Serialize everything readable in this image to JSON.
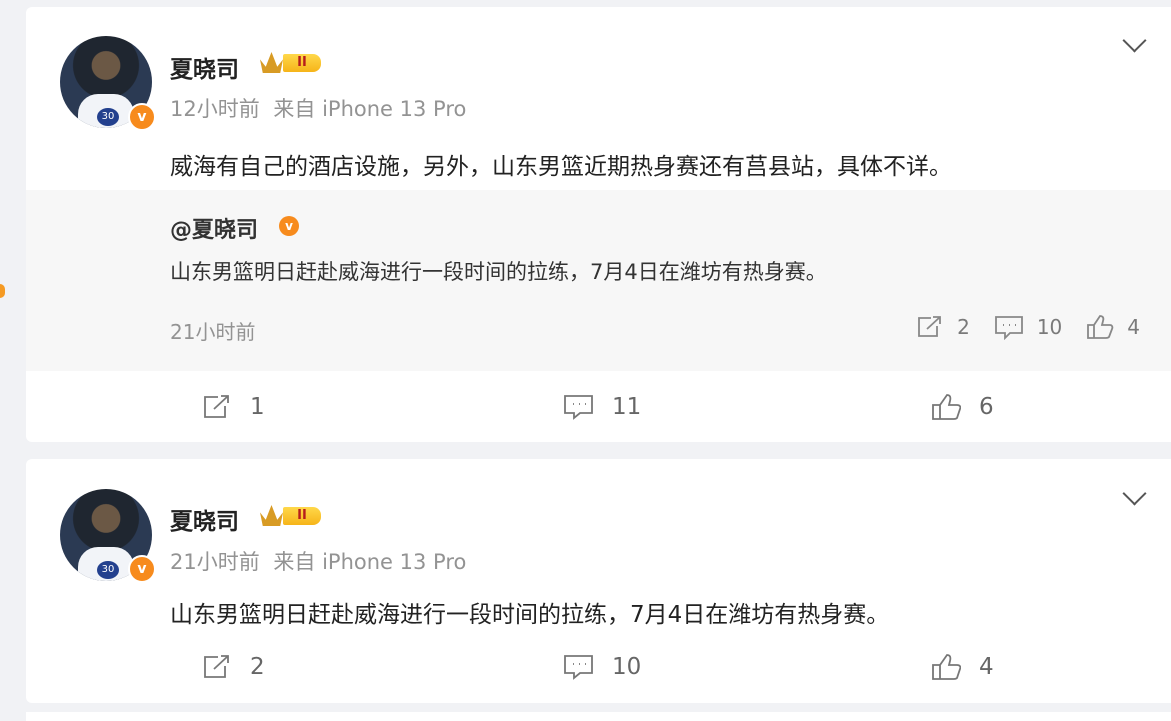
{
  "posts": [
    {
      "username": "夏晓司",
      "badge_level": "II",
      "time": "12小时前",
      "source": "来自 iPhone 13 Pro",
      "text": "威海有自己的酒店设施，另外，山东男篮近期热身赛还有莒县站，具体不详。",
      "retweet": {
        "author": "@夏晓司",
        "text": "山东男篮明日赶赴威海进行一段时间的拉练，7月4日在潍坊有热身赛。",
        "time": "21小时前",
        "actions": {
          "share_count": "2",
          "comment_count": "10",
          "like_count": "4"
        }
      },
      "actions": {
        "share_count": "1",
        "comment_count": "11",
        "like_count": "6"
      }
    },
    {
      "username": "夏晓司",
      "badge_level": "II",
      "time": "21小时前",
      "source": "来自 iPhone 13 Pro",
      "text": "山东男篮明日赶赴威海进行一段时间的拉练，7月4日在潍坊有热身赛。",
      "actions": {
        "share_count": "2",
        "comment_count": "10",
        "like_count": "4"
      }
    }
  ],
  "colors": {
    "verified": "#f78b1d",
    "background": "#f1f2f5",
    "card": "#ffffff",
    "retweet_background": "#f7f7f7"
  },
  "icons": [
    "share-icon",
    "comment-icon",
    "like-icon",
    "chevron-down-icon",
    "verified-icon",
    "crown-icon"
  ]
}
